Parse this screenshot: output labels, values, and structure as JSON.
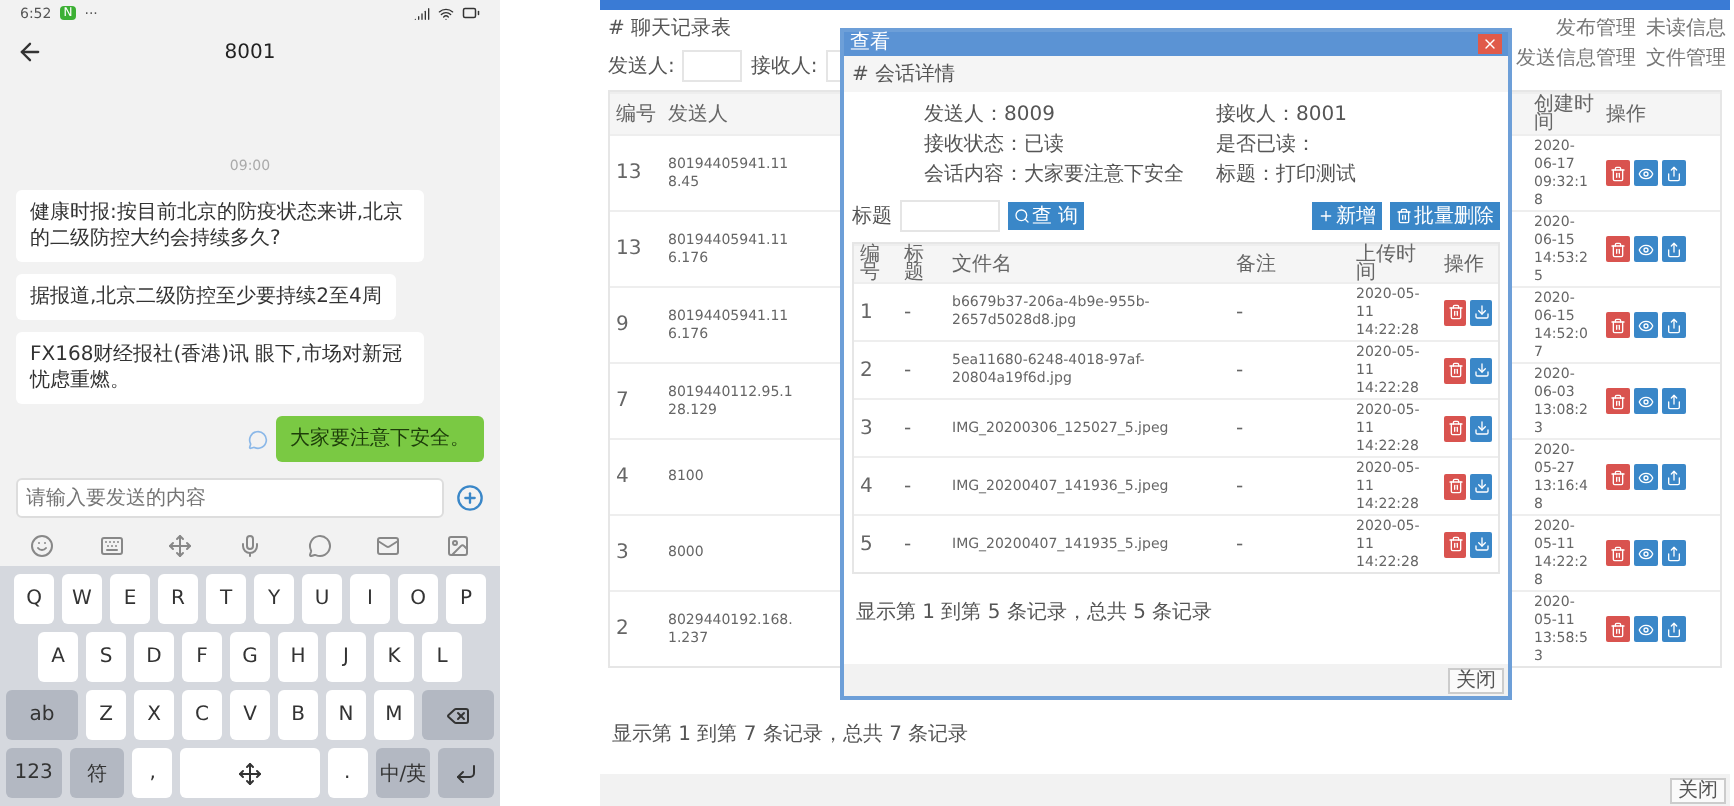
{
  "phone": {
    "status_time": "6:52",
    "status_badge": "N",
    "status_dots": "···",
    "title": "8001",
    "timestamp": "09:00",
    "messages": [
      {
        "text": "健康时报:按目前北京的防疫状态来讲,北京的二级防控大约会持续多久?",
        "self": false
      },
      {
        "text": "据报道,北京二级防控至少要持续2至4周",
        "self": false
      },
      {
        "text": "FX168财经报社(香港)讯 眼下,市场对新冠忧虑重燃。",
        "self": false
      },
      {
        "text": "大家要注意下安全。",
        "self": true
      }
    ],
    "input": {
      "placeholder": "请输入要发送的内容"
    },
    "keyboard": [
      [
        {
          "kind": "letter",
          "label": "Q"
        },
        {
          "kind": "letter",
          "label": "W"
        },
        {
          "kind": "letter",
          "label": "E"
        },
        {
          "kind": "letter",
          "label": "R"
        },
        {
          "kind": "letter",
          "label": "T"
        },
        {
          "kind": "letter",
          "label": "Y"
        },
        {
          "kind": "letter",
          "label": "U"
        },
        {
          "kind": "letter",
          "label": "I"
        },
        {
          "kind": "letter",
          "label": "O"
        },
        {
          "kind": "letter",
          "label": "P"
        }
      ],
      [
        {
          "kind": "letter",
          "label": "A"
        },
        {
          "kind": "letter",
          "label": "S"
        },
        {
          "kind": "letter",
          "label": "D"
        },
        {
          "kind": "letter",
          "label": "F"
        },
        {
          "kind": "letter",
          "label": "G"
        },
        {
          "kind": "letter",
          "label": "H"
        },
        {
          "kind": "letter",
          "label": "J"
        },
        {
          "kind": "letter",
          "label": "K"
        },
        {
          "kind": "letter",
          "label": "L"
        }
      ],
      [
        {
          "kind": "function",
          "label": "ab"
        },
        {
          "kind": "letter",
          "label": "Z"
        },
        {
          "kind": "letter",
          "label": "X"
        },
        {
          "kind": "letter",
          "label": "C"
        },
        {
          "kind": "letter",
          "label": "V"
        },
        {
          "kind": "letter",
          "label": "B"
        },
        {
          "kind": "letter",
          "label": "N"
        },
        {
          "kind": "letter",
          "label": "M"
        },
        {
          "kind": "backspace"
        }
      ],
      [
        {
          "kind": "function",
          "label": "123"
        },
        {
          "kind": "function",
          "label": "符"
        },
        {
          "kind": "letter",
          "label": ","
        },
        {
          "kind": "space"
        },
        {
          "kind": "letter",
          "label": "."
        },
        {
          "kind": "function",
          "label": "中/英"
        },
        {
          "kind": "return"
        }
      ]
    ]
  },
  "web": {
    "title": "# 聊天记录表",
    "nav_tabs": [
      "发布管理",
      "未读信息",
      "发送信息管理",
      "文件管理"
    ],
    "filters": [
      {
        "label": "发送人:"
      },
      {
        "label": "接收人:"
      }
    ],
    "table": {
      "columns": [
        "编号",
        "发送人",
        "创建时间",
        "操作"
      ],
      "rows": [
        {
          "id": "13",
          "sender": "80194405941.118.45",
          "created": "2020-06-17 09:32:18"
        },
        {
          "id": "13",
          "sender": "80194405941.116.176",
          "created": "2020-06-15 14:53:25"
        },
        {
          "id": "9",
          "sender": "80194405941.116.176",
          "created": "2020-06-15 14:52:07"
        },
        {
          "id": "7",
          "sender": "8019440112.95.128.129",
          "created": "2020-06-03 13:08:23"
        },
        {
          "id": "4",
          "sender": "8100",
          "created": "2020-05-27 13:16:48"
        },
        {
          "id": "3",
          "sender": "8000",
          "created": "2020-05-11 14:22:28"
        },
        {
          "id": "2",
          "sender": "8029440192.168.1.237",
          "created": "2020-05-11 13:58:53"
        }
      ]
    },
    "footer": "显示第 1 到第 7 条记录，总共 7 条记录",
    "close_button": "关闭",
    "dialog": {
      "title": "查看",
      "header": "# 会话详情",
      "info": [
        {
          "label": "发送人：",
          "value": "8009"
        },
        {
          "label": "接收人：",
          "value": "8001"
        },
        {
          "label": "接收状态：",
          "value": "已读"
        },
        {
          "label": "是否已读："
        },
        {
          "label": "会话内容：",
          "value": "大家要注意下安全"
        },
        {
          "label": "标题：",
          "value": "打印测试"
        }
      ],
      "search_label": "标题",
      "search_button": "查 询",
      "buttons": [
        "新增",
        "批量删除"
      ],
      "columns": [
        "编号",
        "标题",
        "文件名",
        "备注",
        "上传时间",
        "操作"
      ],
      "rows": [
        {
          "id": "1",
          "title": "-",
          "file": "b6679b37-206a-4b9e-955b-2657d5028d8.jpg",
          "note": "-",
          "uploaded": "2020-05-11 14:22:28"
        },
        {
          "id": "2",
          "title": "-",
          "file": "5ea11680-6248-4018-97af-20804a19f6d.jpg",
          "note": "-",
          "uploaded": "2020-05-11 14:22:28"
        },
        {
          "id": "3",
          "title": "-",
          "file": "IMG_20200306_125027_5.jpeg",
          "note": "-",
          "uploaded": "2020-05-11 14:22:28"
        },
        {
          "id": "4",
          "title": "-",
          "file": "IMG_20200407_141936_5.jpeg",
          "note": "-",
          "uploaded": "2020-05-11 14:22:28"
        },
        {
          "id": "5",
          "title": "-",
          "file": "IMG_20200407_141935_5.jpeg",
          "note": "-",
          "uploaded": "2020-05-11 14:22:28"
        }
      ],
      "footer": "显示第 1 到第 5 条记录，总共 5 条记录",
      "close_button": "关闭"
    }
  }
}
